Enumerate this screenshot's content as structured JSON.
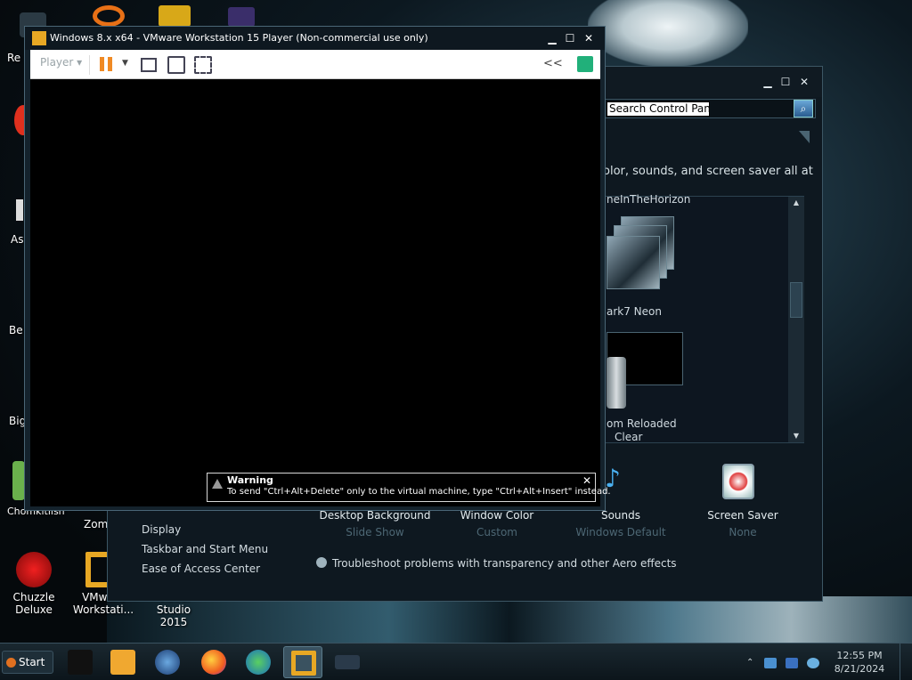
{
  "desktop": {
    "icons": [
      {
        "label_line1": "Chuzzle",
        "label_line2": "Deluxe"
      },
      {
        "label_line1": "VMware",
        "label_line2": "Workstati..."
      },
      {
        "label_line1": "Visual Studio",
        "label_line2": "2015"
      }
    ],
    "partial_labels": [
      "Re",
      "As",
      "Be",
      "Big",
      "Chomkitlish",
      "Zomb"
    ]
  },
  "control_panel": {
    "search_placeholder": "Search Control Panel",
    "description": "olor, sounds, and screen saver all at",
    "themes": {
      "group_label": "neInTheHorizon",
      "theme1": "ark7 Neon",
      "theme2_line1": "om Reloaded",
      "theme2_line2": "Clear"
    },
    "bottom_items": [
      {
        "name": "Desktop Background",
        "value": "Slide Show"
      },
      {
        "name": "Window Color",
        "value": "Custom"
      },
      {
        "name": "Sounds",
        "value": "Windows Default"
      },
      {
        "name": "Screen Saver",
        "value": "None"
      }
    ],
    "left_links": [
      "Display",
      "Taskbar and Start Menu",
      "Ease of Access Center"
    ],
    "troubleshoot": "Troubleshoot problems with transparency and other Aero effects"
  },
  "vmware": {
    "title": "Windows 8.x x64 - VMware Workstation 15 Player (Non-commercial use only)",
    "player_menu": "Player ▾",
    "back_label": "<<",
    "warning": {
      "title": "Warning",
      "body": "To send \"Ctrl+Alt+Delete\" only to the virtual machine, type \"Ctrl+Alt+Insert\" instead."
    }
  },
  "taskbar": {
    "start_label": "Start",
    "clock_time": "12:55 PM",
    "clock_date": "8/21/2024",
    "apps": [
      "terminal-app",
      "media-player-app",
      "globe-app",
      "firefox-app",
      "installer-app",
      "vmware-app",
      "device-app"
    ]
  },
  "colors": {
    "accent_orange": "#f08a24",
    "note_green": "#21b07a",
    "vm_title_icon": "#e8a824"
  }
}
